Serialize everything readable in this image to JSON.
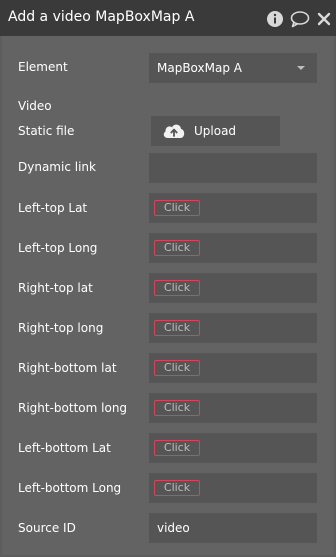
{
  "window": {
    "title": "Add a video MapBoxMap A"
  },
  "icons": {
    "info": "info-icon",
    "comment": "comment-icon",
    "close": "close-icon",
    "upload": "cloud-upload-icon"
  },
  "colors": {
    "titlebar_bg": "#3a3a3a",
    "panel_bg": "#636363",
    "field_bg": "#555555",
    "click_border": "#d3455a"
  },
  "form": {
    "element": {
      "label": "Element",
      "value": "MapBoxMap A"
    },
    "video": {
      "section_label": "Video",
      "static_file_label": "Static file",
      "upload_label": "Upload",
      "dynamic_link_label": "Dynamic link",
      "dynamic_link_value": ""
    },
    "coords": [
      {
        "label": "Left-top Lat",
        "value": "Click"
      },
      {
        "label": "Left-top Long",
        "value": "Click"
      },
      {
        "label": "Right-top lat",
        "value": "Click"
      },
      {
        "label": "Right-top long",
        "value": "Click"
      },
      {
        "label": "Right-bottom lat",
        "value": "Click"
      },
      {
        "label": "Right-bottom long",
        "value": "Click"
      },
      {
        "label": "Left-bottom Lat",
        "value": "Click"
      },
      {
        "label": "Left-bottom Long",
        "value": "Click"
      }
    ],
    "source_id": {
      "label": "Source ID",
      "value": "video"
    }
  }
}
